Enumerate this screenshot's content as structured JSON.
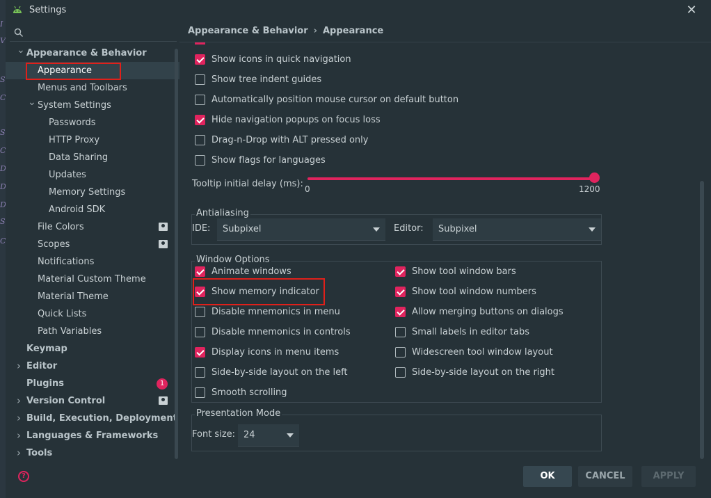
{
  "window": {
    "title": "Settings",
    "close_glyph": "✕",
    "app_icon": "android-icon"
  },
  "search": {
    "placeholder": "",
    "value": ""
  },
  "sidebar": {
    "items": [
      {
        "label": "Appearance & Behavior",
        "level": 0,
        "bold": true,
        "expanded": true
      },
      {
        "label": "Appearance",
        "level": 1,
        "selected": true
      },
      {
        "label": "Menus and Toolbars",
        "level": 1
      },
      {
        "label": "System Settings",
        "level": 1,
        "expanded": true
      },
      {
        "label": "Passwords",
        "level": 2
      },
      {
        "label": "HTTP Proxy",
        "level": 2
      },
      {
        "label": "Data Sharing",
        "level": 2
      },
      {
        "label": "Updates",
        "level": 2
      },
      {
        "label": "Memory Settings",
        "level": 2
      },
      {
        "label": "Android SDK",
        "level": 2
      },
      {
        "label": "File Colors",
        "level": 1,
        "badge": "project-icon"
      },
      {
        "label": "Scopes",
        "level": 1,
        "badge": "project-icon"
      },
      {
        "label": "Notifications",
        "level": 1
      },
      {
        "label": "Material Custom Theme",
        "level": 1
      },
      {
        "label": "Material Theme",
        "level": 1
      },
      {
        "label": "Quick Lists",
        "level": 1
      },
      {
        "label": "Path Variables",
        "level": 1
      },
      {
        "label": "Keymap",
        "level": 0,
        "bold": true
      },
      {
        "label": "Editor",
        "level": 0,
        "bold": true,
        "collapsed": true
      },
      {
        "label": "Plugins",
        "level": 0,
        "bold": true,
        "count": "1"
      },
      {
        "label": "Version Control",
        "level": 0,
        "bold": true,
        "collapsed": true,
        "badge": "project-icon"
      },
      {
        "label": "Build, Execution, Deployment",
        "level": 0,
        "bold": true,
        "collapsed": true
      },
      {
        "label": "Languages & Frameworks",
        "level": 0,
        "bold": true,
        "collapsed": true
      },
      {
        "label": "Tools",
        "level": 0,
        "bold": true,
        "collapsed": true
      }
    ]
  },
  "breadcrumb": {
    "parent": "Appearance & Behavior",
    "separator": "›",
    "current": "Appearance"
  },
  "ui_options": [
    {
      "label": "Show icons in quick navigation",
      "checked": true
    },
    {
      "label": "Show tree indent guides",
      "checked": false
    },
    {
      "label": "Automatically position mouse cursor on default button",
      "checked": false
    },
    {
      "label": "Hide navigation popups on focus loss",
      "checked": true
    },
    {
      "label": "Drag-n-Drop with ALT pressed only",
      "checked": false
    },
    {
      "label": "Show flags for languages",
      "checked": false
    }
  ],
  "tooltip_delay": {
    "label": "Tooltip initial delay (ms):",
    "min_label": "0",
    "max_label": "1200",
    "value_fraction": 1.0
  },
  "antialiasing": {
    "title": "Antialiasing",
    "ide_label": "IDE:",
    "ide_value": "Subpixel",
    "editor_label": "Editor:",
    "editor_value": "Subpixel"
  },
  "window_options": {
    "title": "Window Options",
    "left": [
      {
        "label": "Animate windows",
        "checked": true
      },
      {
        "label": "Show memory indicator",
        "checked": true
      },
      {
        "label": "Disable mnemonics in menu",
        "checked": false
      },
      {
        "label": "Disable mnemonics in controls",
        "checked": false
      },
      {
        "label": "Display icons in menu items",
        "checked": true
      },
      {
        "label": "Side-by-side layout on the left",
        "checked": false
      },
      {
        "label": "Smooth scrolling",
        "checked": false
      }
    ],
    "right": [
      {
        "label": "Show tool window bars",
        "checked": true
      },
      {
        "label": "Show tool window numbers",
        "checked": true
      },
      {
        "label": "Allow merging buttons on dialogs",
        "checked": true
      },
      {
        "label": "Small labels in editor tabs",
        "checked": false
      },
      {
        "label": "Widescreen tool window layout",
        "checked": false
      },
      {
        "label": "Side-by-side layout on the right",
        "checked": false
      }
    ]
  },
  "presentation_mode": {
    "title": "Presentation Mode",
    "font_size_label": "Font size:",
    "font_size_value": "24"
  },
  "footer": {
    "help_glyph": "?",
    "ok_label": "OK",
    "cancel_label": "CANCEL",
    "apply_label": "APPLY"
  },
  "colors": {
    "accent": "#e0245e",
    "highlight_box": "#e0201a",
    "background": "#263238"
  }
}
